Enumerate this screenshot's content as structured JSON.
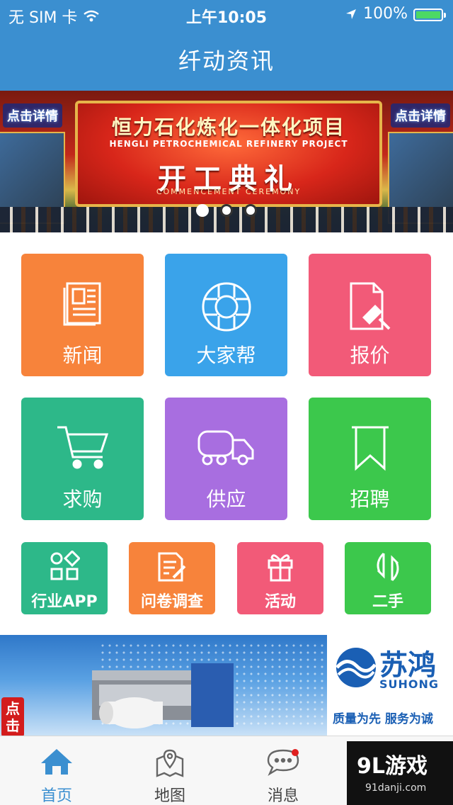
{
  "status_bar": {
    "carrier": "无 SIM 卡",
    "time": "上午10:05",
    "battery": "100%"
  },
  "nav": {
    "title": "纤动资讯"
  },
  "banner": {
    "tag_left": "点击详情",
    "tag_right": "点击详情",
    "headline": "恒力石化炼化一体化项目",
    "headline_en": "HENGLI PETROCHEMICAL REFINERY PROJECT",
    "ceremony": "开工典礼",
    "ceremony_en": "COMMENCEMENT CEREMONY",
    "page_count": 3,
    "active_page": 1
  },
  "tiles_big": [
    {
      "label": "新闻",
      "icon": "newspaper-icon",
      "color": "#f7833b"
    },
    {
      "label": "大家帮",
      "icon": "lifebuoy-icon",
      "color": "#3aa3ea"
    },
    {
      "label": "报价",
      "icon": "quote-document-icon",
      "color": "#f25a78"
    },
    {
      "label": "求购",
      "icon": "shopping-cart-icon",
      "color": "#2db889"
    },
    {
      "label": "供应",
      "icon": "truck-icon",
      "color": "#a86ee0"
    },
    {
      "label": "招聘",
      "icon": "bookmark-icon",
      "color": "#3cc84c"
    }
  ],
  "tiles_small": [
    {
      "label": "行业APP",
      "icon": "apps-icon",
      "color": "#2db889"
    },
    {
      "label": "问卷调查",
      "icon": "survey-icon",
      "color": "#f7833b"
    },
    {
      "label": "活动",
      "icon": "gift-icon",
      "color": "#f25a78"
    },
    {
      "label": "二手",
      "icon": "recycle-arrows-icon",
      "color": "#3cc84c"
    }
  ],
  "ad": {
    "tag": "点击",
    "brand": "苏鸿",
    "brand_en": "SUHONG",
    "slogan": "质量为先  服务为诚"
  },
  "tabs": [
    {
      "label": "首页",
      "icon": "home-icon",
      "active": true
    },
    {
      "label": "地图",
      "icon": "map-icon",
      "active": false
    },
    {
      "label": "消息",
      "icon": "chat-bubble-icon",
      "active": false,
      "badge": true
    },
    {
      "label": "",
      "icon": "user-icon",
      "active": false
    }
  ],
  "watermark": {
    "brand": "9L游戏",
    "url": "91danji.com"
  },
  "colors": {
    "primary": "#3b8fd0",
    "tab_inactive": "#444444"
  }
}
